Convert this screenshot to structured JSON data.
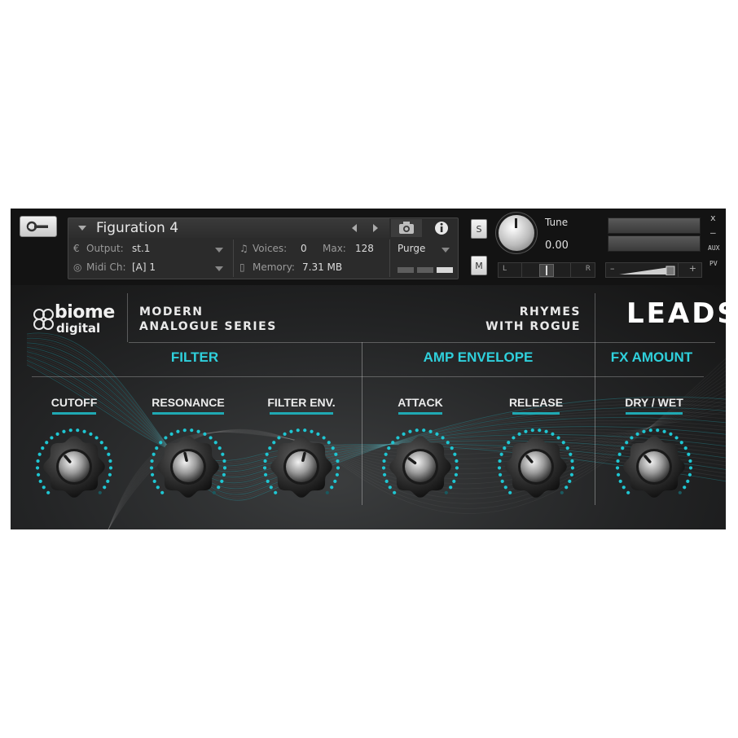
{
  "header": {
    "instrument_name": "Figuration 4",
    "output_label": "Output:",
    "output_value": "st.1",
    "voices_label": "Voices:",
    "voices_value": "0",
    "max_label": "Max:",
    "max_value": "128",
    "midi_label": "Midi Ch:",
    "midi_value": "[A]  1",
    "memory_label": "Memory:",
    "memory_value": "7.31 MB",
    "purge_label": "Purge",
    "solo_label": "S",
    "mute_label": "M",
    "tune_label": "Tune",
    "tune_value": "0.00",
    "pan_left": "L",
    "pan_right": "R",
    "vol_minus": "–",
    "vol_plus": "+",
    "close_label": "x",
    "minimize_label": "–",
    "aux_label": "AUX",
    "pv_label": "PV"
  },
  "branding": {
    "logo_line1": "biome",
    "logo_line2": "digital",
    "series_line1": "MODERN",
    "series_line2": "ANALOGUE SERIES",
    "preset_line1": "RHYMES",
    "preset_line2": "WITH ROGUE",
    "category": "LEADS"
  },
  "sections": [
    {
      "title": "FILTER"
    },
    {
      "title": "AMP ENVELOPE"
    },
    {
      "title": "FX AMOUNT"
    }
  ],
  "knobs": [
    {
      "label": "CUTOFF",
      "value": 0.35
    },
    {
      "label": "RESONANCE",
      "value": 0.45
    },
    {
      "label": "FILTER ENV.",
      "value": 0.55
    },
    {
      "label": "ATTACK",
      "value": 0.3
    },
    {
      "label": "RELEASE",
      "value": 0.35
    },
    {
      "label": "DRY / WET",
      "value": 0.35
    }
  ],
  "colors": {
    "accent": "#2fd0dc",
    "dot_on": "#1fc6d2",
    "dot_off": "#1a5a60",
    "background": "#0c0c0c"
  },
  "icons": {
    "wrench": "wrench-icon",
    "camera": "camera-icon",
    "info": "info-icon"
  }
}
